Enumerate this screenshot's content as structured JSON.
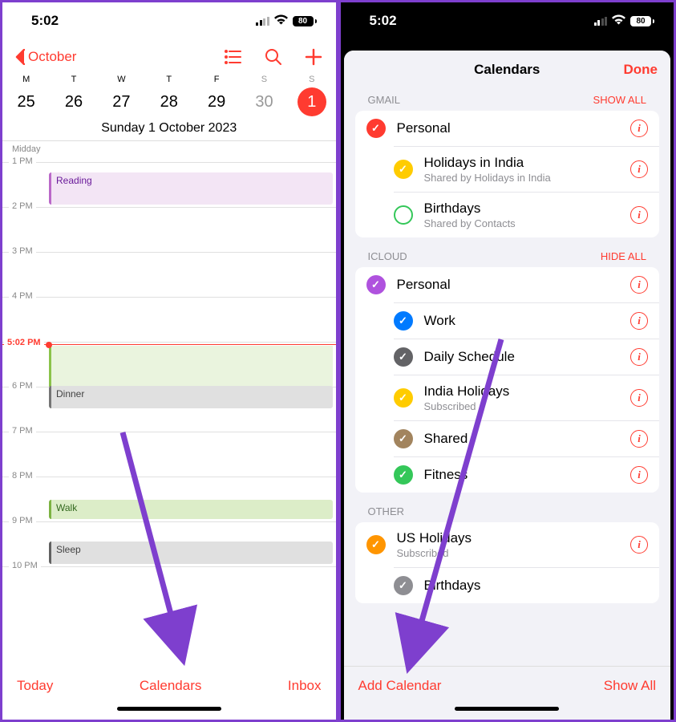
{
  "status": {
    "time": "5:02",
    "battery": "80"
  },
  "left": {
    "back": "October",
    "days": [
      {
        "letter": "M",
        "num": "25"
      },
      {
        "letter": "T",
        "num": "26"
      },
      {
        "letter": "W",
        "num": "27"
      },
      {
        "letter": "T",
        "num": "28"
      },
      {
        "letter": "F",
        "num": "29"
      },
      {
        "letter": "S",
        "num": "30"
      },
      {
        "letter": "S",
        "num": "1"
      }
    ],
    "dateLine": "Sunday  1 October 2023",
    "midday": "Midday",
    "hours": [
      "1 PM",
      "2 PM",
      "3 PM",
      "4 PM",
      "",
      "6 PM",
      "7 PM",
      "8 PM",
      "9 PM",
      "10 PM"
    ],
    "nowLabel": "5:02 PM",
    "events": {
      "reading": "Reading",
      "dinner": "Dinner",
      "walk": "Walk",
      "sleep": "Sleep"
    },
    "footer": {
      "today": "Today",
      "calendars": "Calendars",
      "inbox": "Inbox"
    }
  },
  "right": {
    "title": "Calendars",
    "done": "Done",
    "sections": {
      "gmail": {
        "header": "GMAIL",
        "action": "SHOW ALL",
        "items": [
          {
            "name": "Personal",
            "color": "#ff3b30",
            "checked": true
          },
          {
            "name": "Holidays in India",
            "sub": "Shared by Holidays in India",
            "color": "#ffcc00",
            "checked": true
          },
          {
            "name": "Birthdays",
            "sub": "Shared by Contacts",
            "color": "#34c759",
            "hollow": true
          }
        ]
      },
      "icloud": {
        "header": "ICLOUD",
        "action": "HIDE ALL",
        "items": [
          {
            "name": "Personal",
            "color": "#af52de",
            "checked": true
          },
          {
            "name": "Work",
            "color": "#007aff",
            "checked": true
          },
          {
            "name": "Daily Schedule",
            "color": "#636366",
            "checked": true
          },
          {
            "name": "India Holidays",
            "sub": "Subscribed",
            "color": "#ffcc00",
            "checked": true
          },
          {
            "name": "Shared",
            "color": "#a2845e",
            "checked": true
          },
          {
            "name": "Fitness",
            "color": "#34c759",
            "checked": true
          }
        ]
      },
      "other": {
        "header": "OTHER",
        "items": [
          {
            "name": "US Holidays",
            "sub": "Subscribed",
            "color": "#ff9500",
            "checked": true
          },
          {
            "name": "Birthdays",
            "color": "#8e8e93",
            "checked": true,
            "noInfo": true
          }
        ]
      }
    },
    "footer": {
      "add": "Add Calendar",
      "showAll": "Show All"
    }
  }
}
